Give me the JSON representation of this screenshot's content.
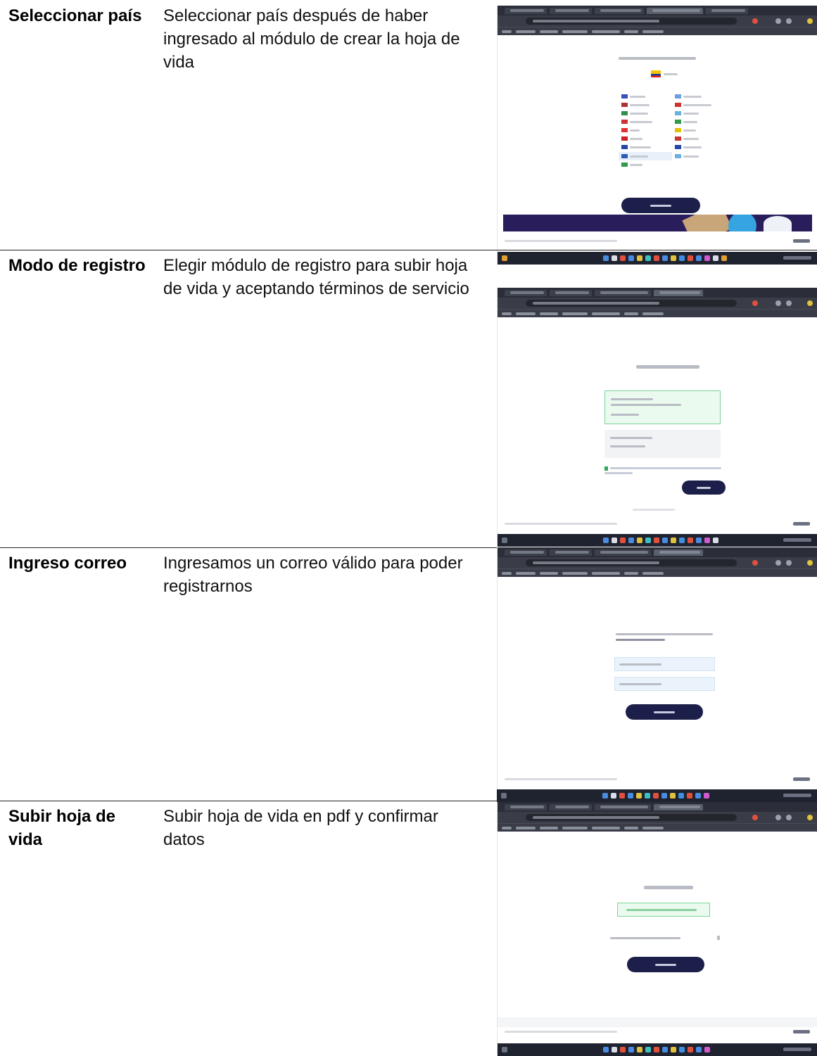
{
  "rows": [
    {
      "step": "Seleccionar país",
      "description": "Seleccionar país después de haber ingresado al módulo de crear la hoja de vida"
    },
    {
      "step": "Modo de registro",
      "description": "Elegir módulo de registro para subir hoja de vida y aceptando términos de servicio"
    },
    {
      "step": "Ingreso correo",
      "description": "Ingresamos un correo válido para poder registrarnos"
    },
    {
      "step": "Subir hoja de vida",
      "description": "Subir hoja de vida en pdf y confirmar datos"
    }
  ],
  "colors": {
    "border": "#222222",
    "browser_chrome": "#2b2e38",
    "taskbar": "#1f2330",
    "primary_button": "#1c1f4a",
    "success_box": "#eafaee",
    "banner": "#2a1d5c"
  },
  "icons": {
    "browser": "browser-window-icon",
    "flag": "country-flag-icon",
    "checkbox": "checkbox-icon",
    "upload": "upload-icon"
  }
}
